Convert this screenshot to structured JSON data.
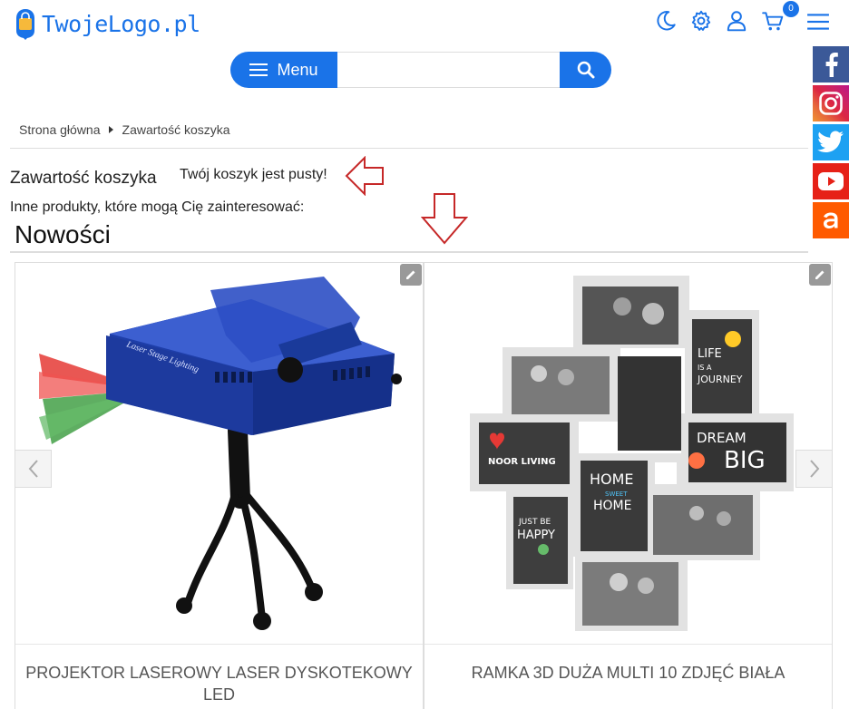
{
  "header": {
    "logo_text": "TwojeLogo.pl",
    "icons": [
      "moon-icon",
      "gear-icon",
      "user-icon",
      "cart-icon",
      "hamburger-icon"
    ],
    "cart_count": "0"
  },
  "search": {
    "menu_label": "Menu",
    "placeholder": "",
    "value": ""
  },
  "social": [
    "facebook",
    "instagram",
    "twitter",
    "youtube",
    "allegro"
  ],
  "breadcrumb": {
    "home": "Strona główna",
    "current": "Zawartość koszyka"
  },
  "cart": {
    "title": "Zawartość koszyka",
    "empty_message": "Twój koszyk jest pusty!",
    "other_products": "Inne produkty, które mogą Cię zainteresować:"
  },
  "section": {
    "title": "Nowości"
  },
  "products": [
    {
      "name": "PROJEKTOR LASEROWY LASER DYSKOTEKOWY LED",
      "image_label": "Laser Stage Lighting"
    },
    {
      "name": "RAMKA 3D DUŻA MULTI 10 ZDJĘĆ BIAŁA",
      "image_labels": [
        "LIFE IS A JOURNEY",
        "NOOR LIVING",
        "HOME SWEET HOME",
        "DREAM BIG",
        "JUST BE HAPPY"
      ]
    }
  ],
  "colors": {
    "accent": "#1a73e8",
    "annotation_red": "#c62828",
    "facebook": "#3b5998",
    "instagram": "#c13584",
    "twitter": "#1da1f2",
    "youtube": "#e62117",
    "allegro": "#ff5a00"
  }
}
